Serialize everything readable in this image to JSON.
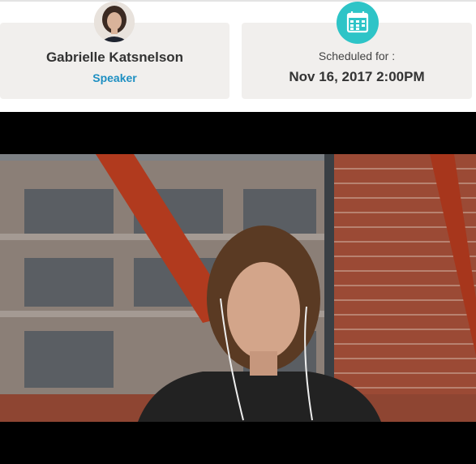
{
  "speaker": {
    "name": "Gabrielle Katsnelson",
    "role": "Speaker",
    "avatar_icon": "person-avatar"
  },
  "schedule": {
    "label": "Scheduled for :",
    "datetime": "Nov 16, 2017 2:00PM",
    "icon": "calendar-icon"
  },
  "colors": {
    "accent": "#2ec4c7",
    "link": "#1d8fc2",
    "card_bg": "#f1efed"
  },
  "video": {
    "description_icon": "video-frame"
  }
}
